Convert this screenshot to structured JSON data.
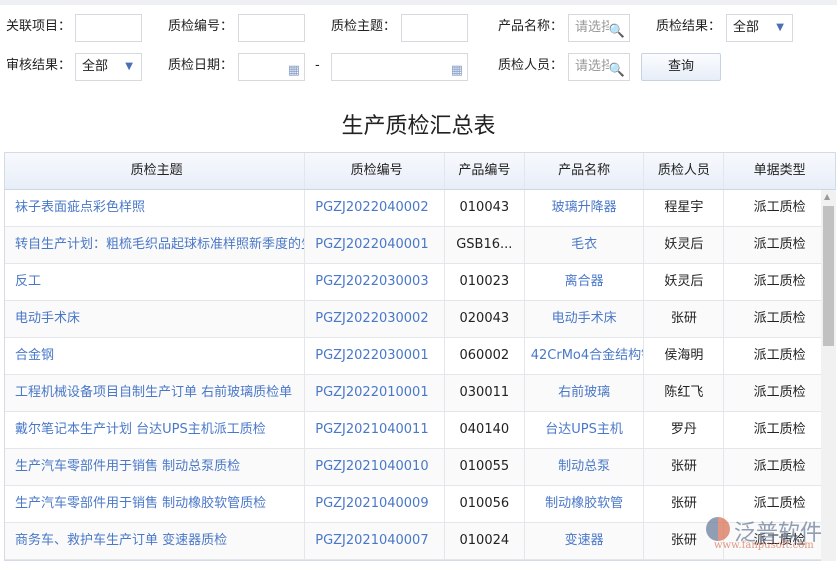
{
  "filters": {
    "project_label": "关联项目：",
    "code_label": "质检编号：",
    "subject_label": "质检主题：",
    "product_label": "产品名称：",
    "product_placeholder": "请选择",
    "result_label": "质检结果：",
    "result_value": "全部",
    "audit_label": "审核结果：",
    "audit_value": "全部",
    "date_label": "质检日期：",
    "date_sep": "-",
    "person_label": "质检人员：",
    "person_placeholder": "请选择",
    "query_label": "查询"
  },
  "title": "生产质检汇总表",
  "table": {
    "headers": [
      "质检主题",
      "质检编号",
      "产品编号",
      "产品名称",
      "质检人员",
      "单据类型"
    ],
    "rows": [
      [
        "袜子表面疵点彩色样照",
        "PGZJ2022040002",
        "010043",
        "玻璃升降器",
        "程星宇",
        "派工质检"
      ],
      [
        "转自生产计划：粗梳毛织品起球标准样照新季度的生产计划",
        "PGZJ2022040001",
        "GSB16...",
        "毛衣",
        "妖灵后",
        "派工质检"
      ],
      [
        "反工",
        "PGZJ2022030003",
        "010023",
        "离合器",
        "妖灵后",
        "派工质检"
      ],
      [
        "电动手术床",
        "PGZJ2022030002",
        "020043",
        "电动手术床",
        "张研",
        "派工质检"
      ],
      [
        "合金钢",
        "PGZJ2022030001",
        "060002",
        "42CrMo4合金结构钢",
        "侯海明",
        "派工质检"
      ],
      [
        "工程机械设备项目自制生产订单 右前玻璃质检单",
        "PGZJ2022010001",
        "030011",
        "右前玻璃",
        "陈红飞",
        "派工质检"
      ],
      [
        "戴尔笔记本生产计划 台达UPS主机派工质检",
        "PGZJ2021040011",
        "040140",
        "台达UPS主机",
        "罗丹",
        "派工质检"
      ],
      [
        "生产汽车零部件用于销售 制动总泵质检",
        "PGZJ2021040010",
        "010055",
        "制动总泵",
        "张研",
        "派工质检"
      ],
      [
        "生产汽车零部件用于销售 制动橡胶软管质检",
        "PGZJ2021040009",
        "010056",
        "制动橡胶软管",
        "张研",
        "派工质检"
      ],
      [
        "商务车、救护车生产订单 变速器质检",
        "PGZJ2021040007",
        "010024",
        "变速器",
        "张研",
        "派工质检"
      ]
    ]
  },
  "watermark": {
    "brand": "泛普软件",
    "url": "www.fanpusoft.com"
  },
  "colors": {
    "link": "#4a78c8",
    "accent": "#4a6fb5"
  }
}
